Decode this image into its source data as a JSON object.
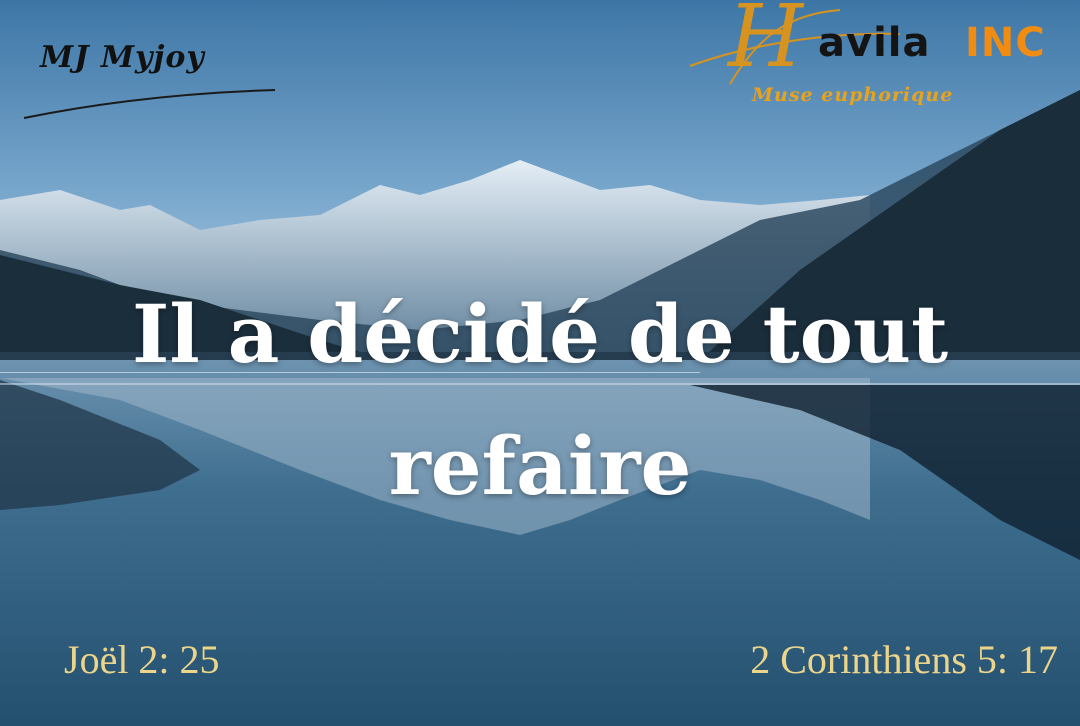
{
  "author": "MJ Myjoy",
  "brand": {
    "initial": "H",
    "name": "avila",
    "suffix": "INC",
    "tagline": "Muse euphorique"
  },
  "verse_title": {
    "line1": "Il a décidé de tout",
    "line2": "refaire"
  },
  "references": {
    "left": "Joël 2: 25",
    "right": "2 Corinthiens 5: 17"
  },
  "colors": {
    "sky_top": "#3f78a8",
    "sky_horizon": "#b9d4e8",
    "lake": "#2f5e7e",
    "reference_text": "#ecd48a",
    "brand_orange": "#f08c12"
  }
}
